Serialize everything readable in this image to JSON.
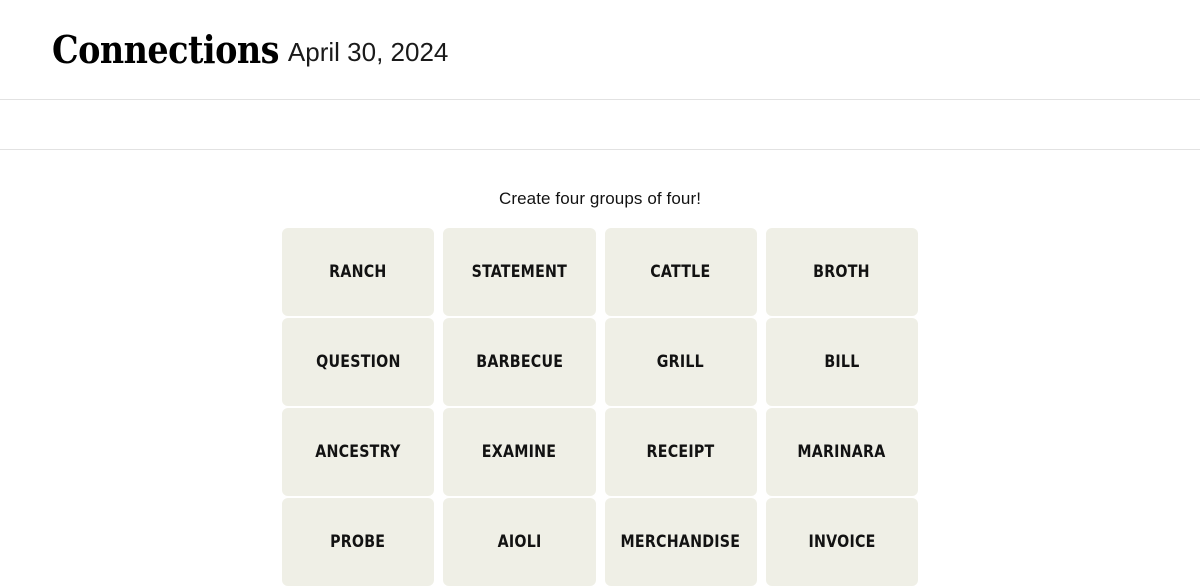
{
  "header": {
    "title": "Connections",
    "date": "April 30, 2024"
  },
  "board": {
    "instruction": "Create four groups of four!",
    "tiles": [
      {
        "label": "RANCH"
      },
      {
        "label": "STATEMENT"
      },
      {
        "label": "CATTLE"
      },
      {
        "label": "BROTH"
      },
      {
        "label": "QUESTION"
      },
      {
        "label": "BARBECUE"
      },
      {
        "label": "GRILL"
      },
      {
        "label": "BILL"
      },
      {
        "label": "ANCESTRY"
      },
      {
        "label": "EXAMINE"
      },
      {
        "label": "RECEIPT"
      },
      {
        "label": "MARINARA"
      },
      {
        "label": "PROBE"
      },
      {
        "label": "AIOLI"
      },
      {
        "label": "MERCHANDISE"
      },
      {
        "label": "INVOICE"
      }
    ]
  },
  "colors": {
    "tile_background": "#EFEFE6",
    "page_background": "#FFFFFF",
    "rule": "#E2E2E2",
    "text": "#121212"
  }
}
